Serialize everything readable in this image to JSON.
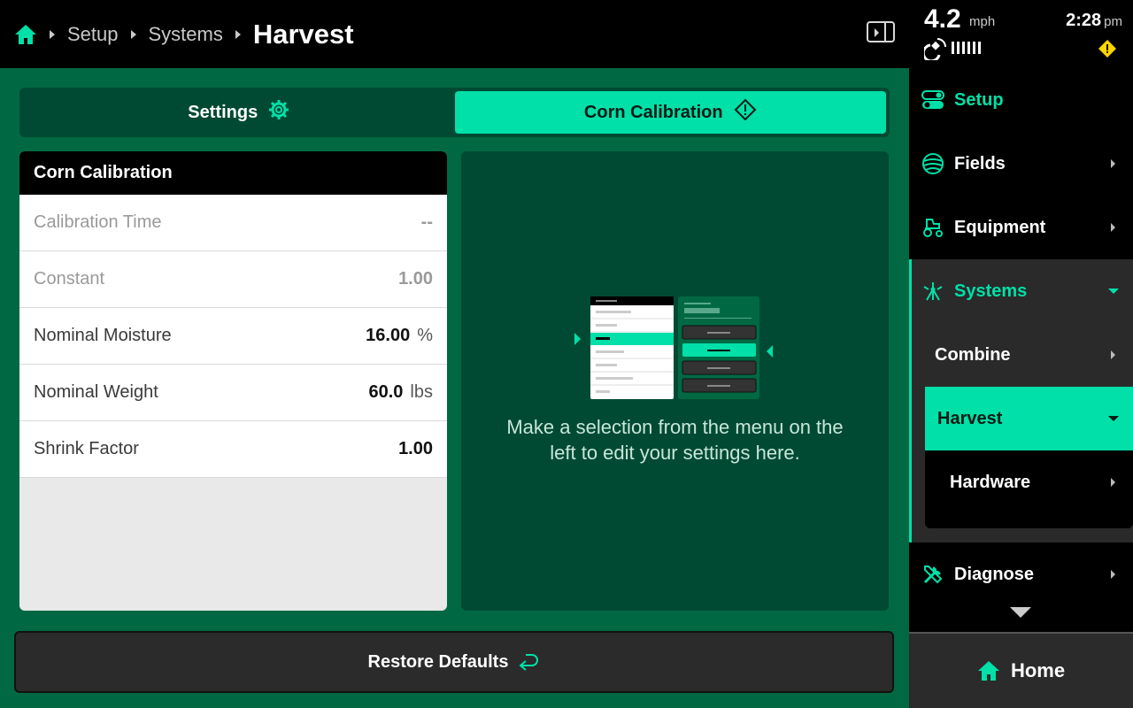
{
  "breadcrumb": {
    "home_icon": "home-icon",
    "items": [
      "Setup",
      "Systems"
    ],
    "current": "Harvest"
  },
  "status": {
    "speed": "4.2",
    "speed_unit": "mph",
    "time": "2:28",
    "time_suffix": "pm"
  },
  "tabs": {
    "settings_label": "Settings",
    "corn_label": "Corn Calibration"
  },
  "calibration": {
    "title": "Corn Calibration",
    "rows": [
      {
        "label": "Calibration Time",
        "value": "--",
        "unit": ""
      },
      {
        "label": "Constant",
        "value": "1.00",
        "unit": ""
      },
      {
        "label": "Nominal Moisture",
        "value": "16.00",
        "unit": "%"
      },
      {
        "label": "Nominal Weight",
        "value": "60.0",
        "unit": "lbs"
      },
      {
        "label": "Shrink Factor",
        "value": "1.00",
        "unit": ""
      }
    ]
  },
  "info": {
    "message": "Make a selection from the menu on the left to edit your settings here."
  },
  "actions": {
    "restore_label": "Restore Defaults"
  },
  "sidebar": {
    "items": [
      {
        "label": "Setup"
      },
      {
        "label": "Fields"
      },
      {
        "label": "Equipment"
      },
      {
        "label": "Systems"
      },
      {
        "label": "Diagnose"
      }
    ],
    "systems_sub": [
      {
        "label": "Combine"
      },
      {
        "label": "Harvest"
      },
      {
        "label": "Hardware"
      }
    ]
  },
  "home_button": {
    "label": "Home"
  },
  "colors": {
    "accent": "#00e0a8",
    "main_bg": "#006944",
    "panel_bg": "#004a33",
    "warning": "#ffd400"
  }
}
